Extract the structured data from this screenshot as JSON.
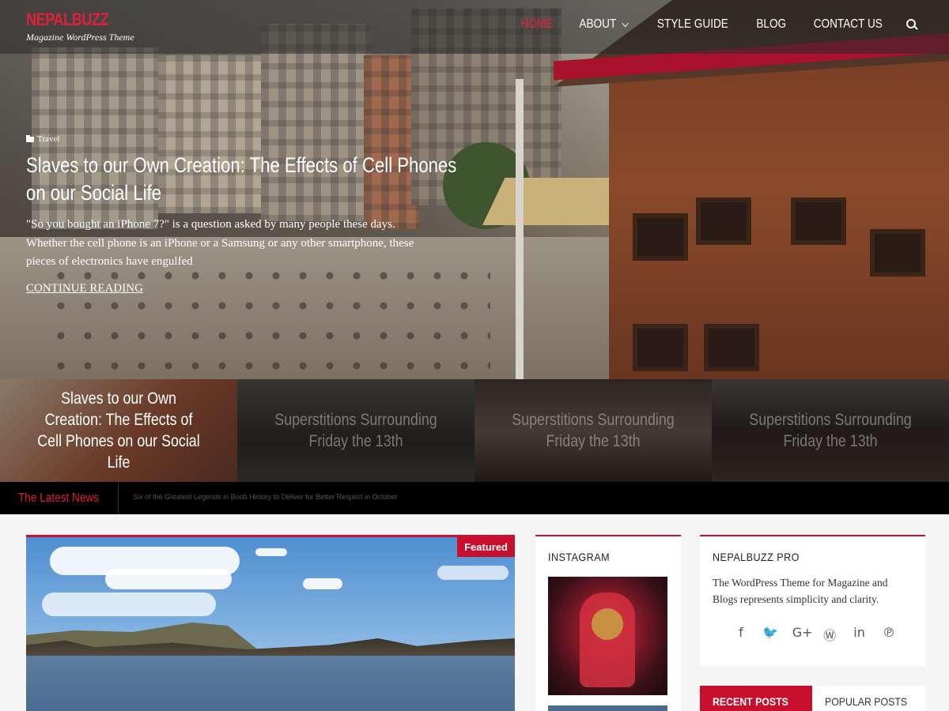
{
  "site": {
    "name": "NEPALBUZZ",
    "tagline": "Magazine WordPress Theme"
  },
  "nav": {
    "items": [
      {
        "label": "HOME",
        "active": true
      },
      {
        "label": "ABOUT",
        "has_dropdown": true
      },
      {
        "label": "STYLE GUIDE"
      },
      {
        "label": "BLOG"
      },
      {
        "label": "CONTACT US"
      }
    ],
    "search_icon": "search-icon"
  },
  "hero": {
    "category": "Travel",
    "title_line1": "Slaves to our Own Creation: The Effects of Cell Phones",
    "title_line2": "on our Social Life",
    "excerpt": "\"So you bought an iPhone 7?\" is a question asked by many people these days. Whether the cell phone is an iPhone or a Samsung or any other smartphone, these pieces of electronics have engulfed",
    "cta": "CONTINUE READING"
  },
  "slides": [
    {
      "title": "Slaves to our Own Creation: The Effects of Cell Phones on our Social Life",
      "active": true
    },
    {
      "title": "Superstitions Surrounding Friday the 13th"
    },
    {
      "title": "Superstitions Surrounding Friday the 13th"
    },
    {
      "title": "Superstitions Surrounding Friday the 13th"
    }
  ],
  "ticker": {
    "label": "The Latest News",
    "headline": "Six of the Greatest Legends in Boob History to Deliver for Better Respect in October"
  },
  "featured": {
    "badge": "Featured"
  },
  "instagram": {
    "title": "INSTAGRAM"
  },
  "pro": {
    "title": "NEPALBUZZ PRO",
    "text": "The WordPress Theme for Magazine and Blogs represents simplicity and clarity.",
    "social": [
      {
        "icon": "facebook-icon",
        "glyph": "f"
      },
      {
        "icon": "twitter-icon",
        "glyph": "🐦"
      },
      {
        "icon": "google-plus-icon",
        "glyph": "G+"
      },
      {
        "icon": "wordpress-icon",
        "glyph": "Ⓦ"
      },
      {
        "icon": "linkedin-icon",
        "glyph": "in"
      },
      {
        "icon": "pinterest-icon",
        "glyph": "℗"
      }
    ]
  },
  "post_tabs": [
    {
      "label": "RECENT POSTS",
      "active": true
    },
    {
      "label": "POPULAR POSTS"
    }
  ],
  "colors": {
    "accent": "#c8102e",
    "logo": "#e0203a",
    "ticker_bg": "#000000"
  }
}
